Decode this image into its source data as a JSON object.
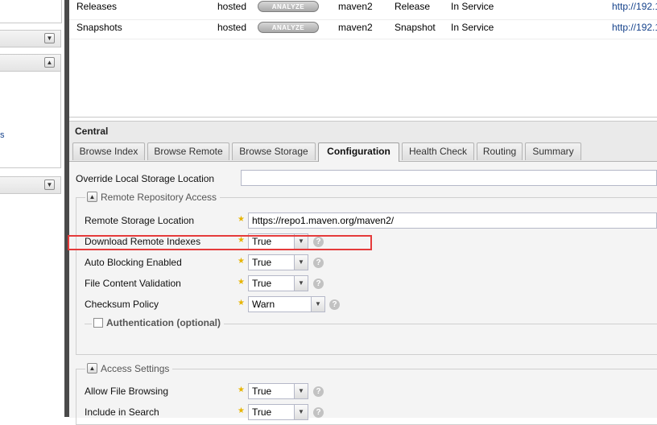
{
  "sidebar": {
    "partial_link": "s"
  },
  "repositories": {
    "analyze_label": "ANALYZE",
    "rows": [
      {
        "name": "Releases",
        "type": "hosted",
        "format": "maven2",
        "policy": "Release",
        "status": "In Service",
        "url": "http://192.1"
      },
      {
        "name": "Snapshots",
        "type": "hosted",
        "format": "maven2",
        "policy": "Snapshot",
        "status": "In Service",
        "url": "http://192.1"
      }
    ]
  },
  "panel": {
    "title": "Central",
    "tabs": [
      "Browse Index",
      "Browse Remote",
      "Browse Storage",
      "Configuration",
      "Health Check",
      "Routing",
      "Summary"
    ],
    "active_tab": "Configuration"
  },
  "config": {
    "override_label": "Override Local Storage Location",
    "override_value": "",
    "remote_access": {
      "legend": "Remote Repository Access",
      "remote_location_label": "Remote Storage Location",
      "remote_location_value": "https://repo1.maven.org/maven2/",
      "download_indexes_label": "Download Remote Indexes",
      "download_indexes_value": "True",
      "auto_blocking_label": "Auto Blocking Enabled",
      "auto_blocking_value": "True",
      "file_validation_label": "File Content Validation",
      "file_validation_value": "True",
      "checksum_label": "Checksum Policy",
      "checksum_value": "Warn",
      "auth_legend": "Authentication (optional)"
    },
    "access_settings": {
      "legend": "Access Settings",
      "file_browsing_label": "Allow File Browsing",
      "file_browsing_value": "True",
      "include_search_label": "Include in Search",
      "include_search_value": "True"
    }
  },
  "colors": {
    "highlight": "#e53b3b",
    "required_star": "#e7b400",
    "link": "#15428b"
  }
}
